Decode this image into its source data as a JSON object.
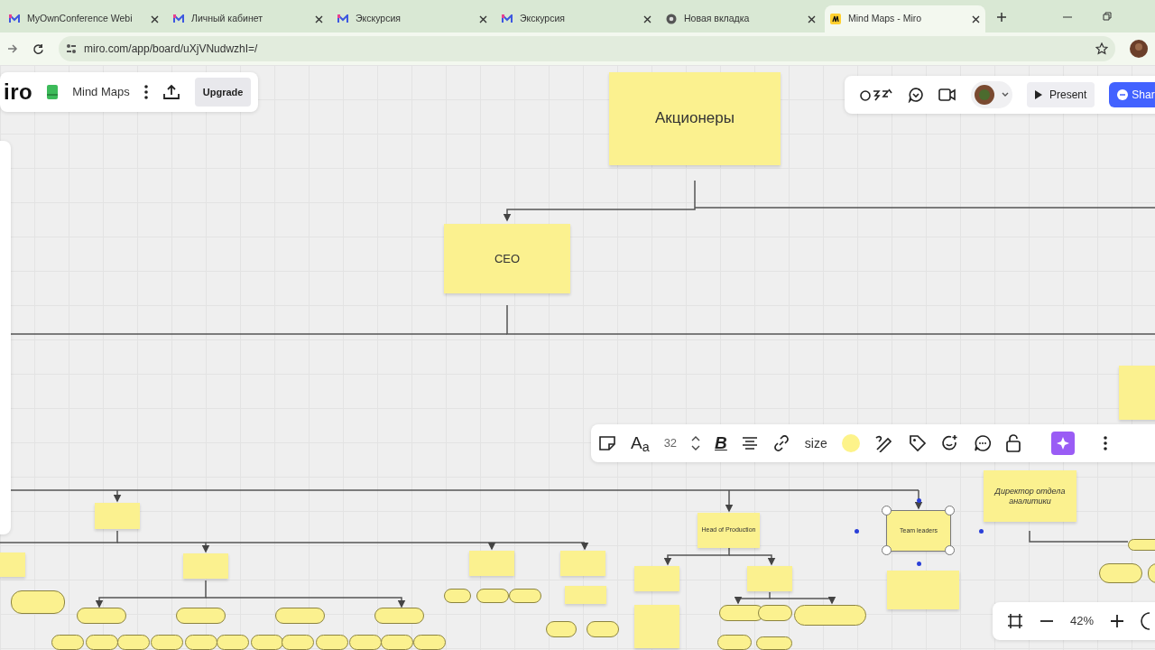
{
  "browser": {
    "tabs": [
      {
        "title": "MyOwnConference Webi",
        "kind": "conference",
        "selected": false
      },
      {
        "title": "Личный кабинет",
        "kind": "conference",
        "selected": false
      },
      {
        "title": "Экскурсия",
        "kind": "conference",
        "selected": false
      },
      {
        "title": "Экскурсия",
        "kind": "conference",
        "selected": false
      },
      {
        "title": "Новая вкладка",
        "kind": "chrome",
        "selected": false
      },
      {
        "title": "Mind Maps - Miro",
        "kind": "miro",
        "selected": true
      }
    ],
    "url": "miro.com/app/board/uXjVNudwzhI=/"
  },
  "board": {
    "logo": "iro",
    "name": "Mind Maps",
    "upgrade": "Upgrade",
    "present": "Present",
    "share": "Shar"
  },
  "context_toolbar": {
    "font_button": "A$_{a}$",
    "font_size": "32",
    "bold": "B",
    "size_label": "size"
  },
  "zoom": "42%",
  "nodes": [
    {
      "text": "Акционеры",
      "italic": false,
      "selected": false
    },
    {
      "text": "CEO",
      "italic": false,
      "selected": false
    },
    {
      "text": "Head of Production",
      "italic": false,
      "selected": false
    },
    {
      "text": "Team leaders",
      "italic": false,
      "selected": true
    },
    {
      "text": "Директор отдела аналитики",
      "italic": true,
      "selected": false
    }
  ]
}
